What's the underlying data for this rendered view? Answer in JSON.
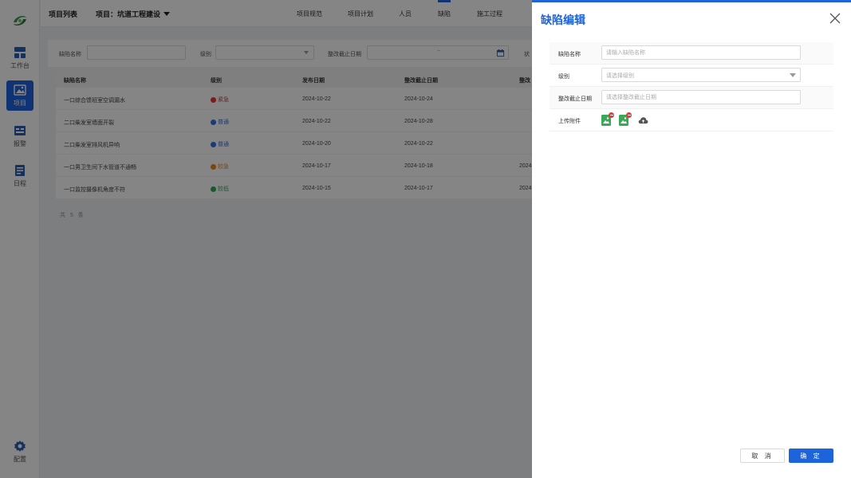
{
  "sidebar": {
    "items": [
      {
        "label": "工作台",
        "icon": "dashboard-icon"
      },
      {
        "label": "项目",
        "icon": "image-icon",
        "active": true
      },
      {
        "label": "报警",
        "icon": "alarm-icon"
      },
      {
        "label": "日程",
        "icon": "calendar-list-icon"
      }
    ],
    "settings_label": "配置"
  },
  "header": {
    "list_label": "项目列表",
    "project_label": "项目：坑道工程建设",
    "tabs": [
      "项目规范",
      "项目计划",
      "人员",
      "缺陷",
      "施工过程"
    ],
    "active_tab": "缺陷"
  },
  "filters": {
    "name_label": "缺陷名称",
    "level_label": "级别",
    "deadline_label": "整改截止日期",
    "range_separator": "~",
    "truncated_label": "状"
  },
  "table": {
    "headers": [
      "缺陷名称",
      "级别",
      "发布日期",
      "整改截止日期",
      "整改"
    ],
    "rows": [
      {
        "name": "一口综合馈班室空调漏水",
        "level": "紧急",
        "level_color": "#e23b3b",
        "publish": "2024-10-22",
        "deadline": "2024-10-24",
        "extra": ""
      },
      {
        "name": "二口柴发室墙面开裂",
        "level": "普通",
        "level_color": "#3a6fd8",
        "publish": "2024-10-22",
        "deadline": "2024-10-28",
        "extra": ""
      },
      {
        "name": "二口柴发室排风机异响",
        "level": "普通",
        "level_color": "#3a6fd8",
        "publish": "2024-10-20",
        "deadline": "2024-10-22",
        "extra": ""
      },
      {
        "name": "一口男卫生间下水管道不通畅",
        "level": "较急",
        "level_color": "#e8892b",
        "publish": "2024-10-17",
        "deadline": "2024-10-18",
        "extra": "2024"
      },
      {
        "name": "一口监控摄像机角度不符",
        "level": "较低",
        "level_color": "#3aa857",
        "publish": "2024-10-15",
        "deadline": "2024-10-17",
        "extra": "2024"
      }
    ],
    "total": "共 5 条"
  },
  "drawer": {
    "title": "缺陷编辑",
    "fields": {
      "name_label": "缺陷名称",
      "name_placeholder": "请输入缺陷名称",
      "level_label": "级别",
      "level_placeholder": "请选择级别",
      "deadline_label": "整改截止日期",
      "deadline_placeholder": "请选择整改截止日期",
      "attach_label": "上传附件"
    },
    "cancel_label": "取 消",
    "ok_label": "确 定"
  },
  "colors": {
    "primary": "#1d63dc",
    "attachment": "#3aa857",
    "remove": "#e23b3b"
  }
}
